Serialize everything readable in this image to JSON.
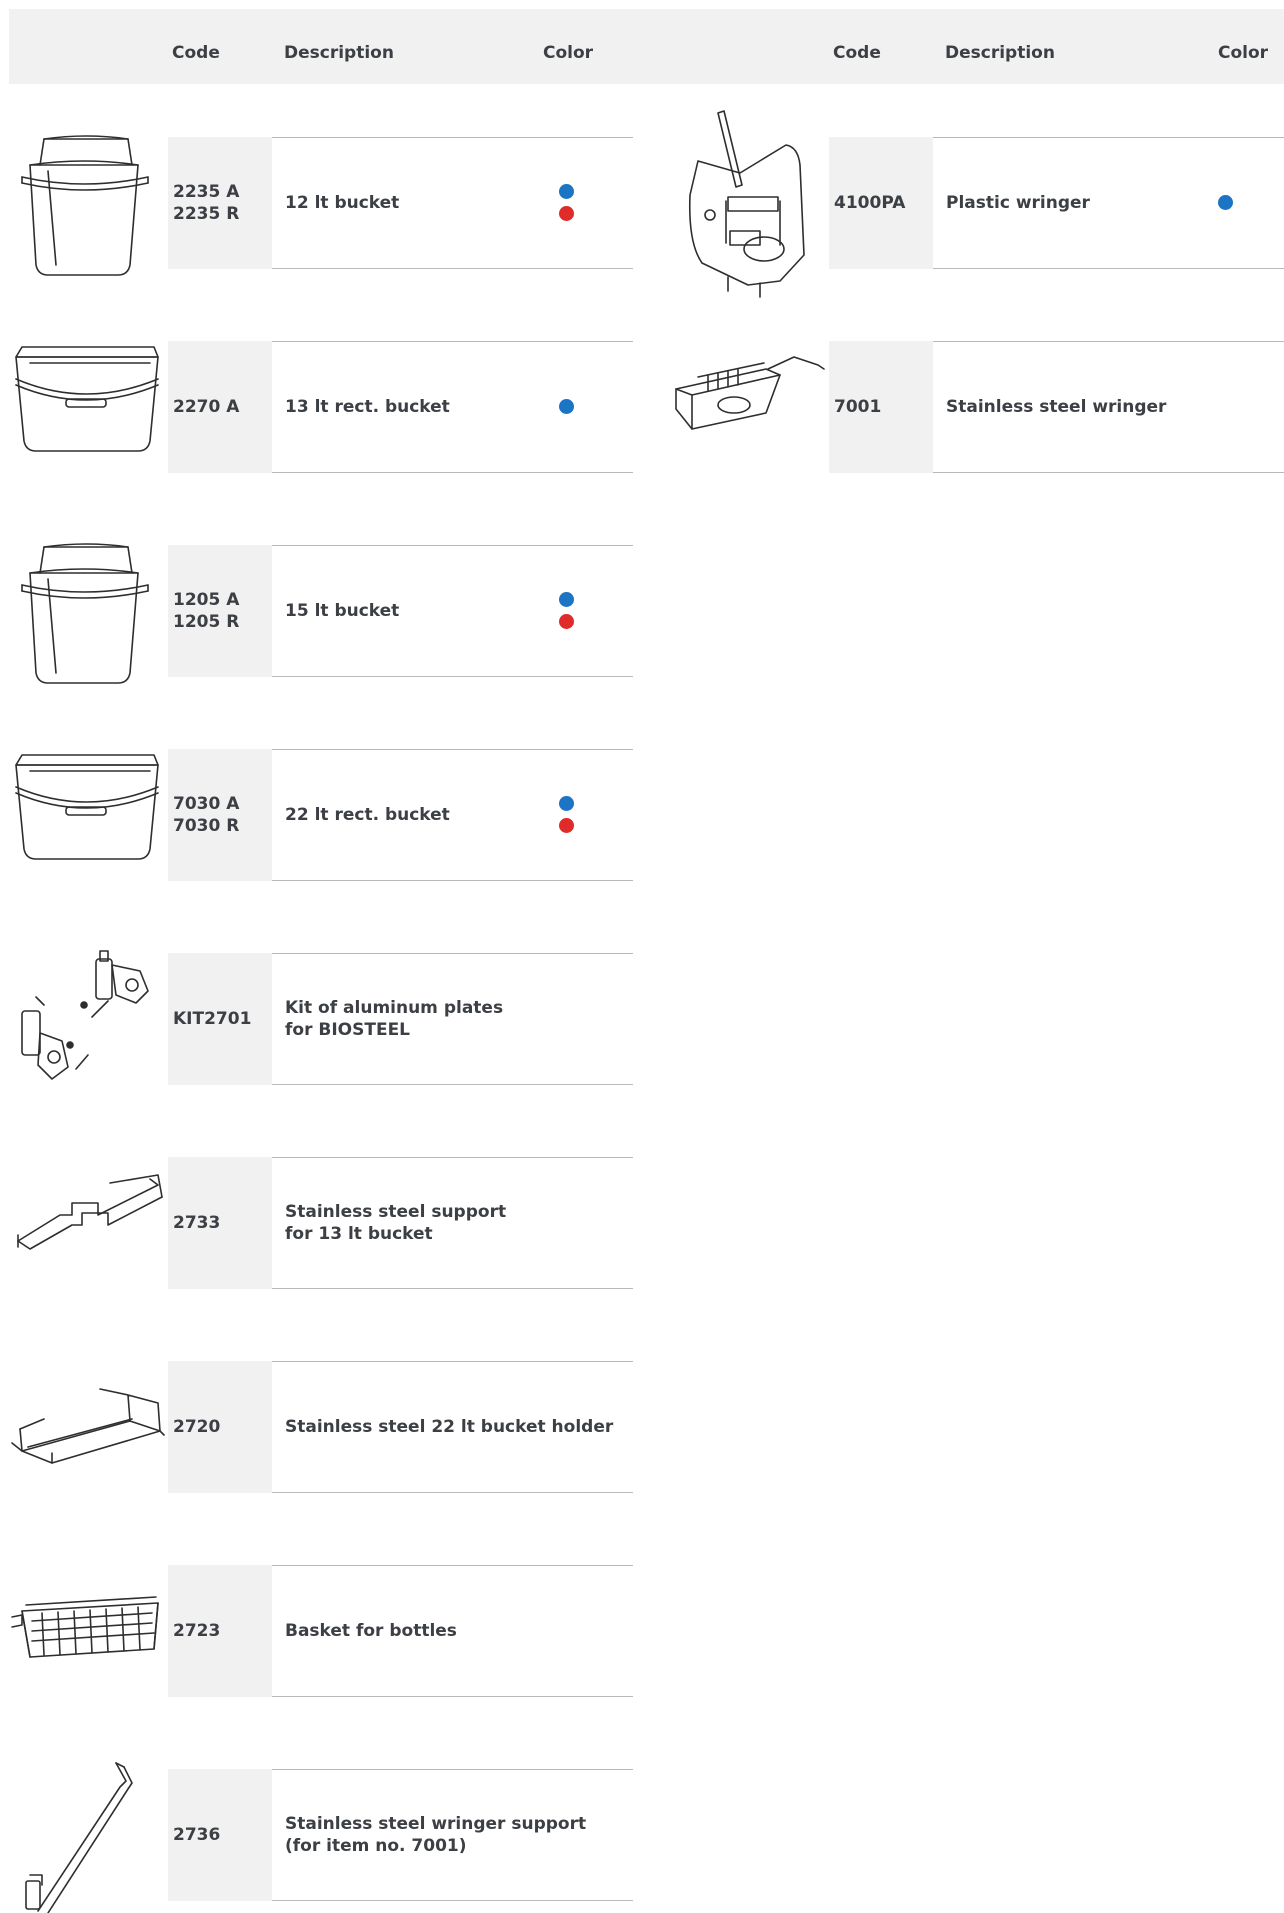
{
  "header": {
    "left": {
      "code": "Code",
      "description": "Description",
      "color": "Color"
    },
    "right": {
      "code": "Code",
      "description": "Description",
      "color": "Color"
    }
  },
  "colors": {
    "blue": "#1b75c4",
    "red": "#e02b2b",
    "code_bg": "#f1f1f2",
    "header_bg": "#f1f1f2",
    "rule": "#b7b8ba"
  },
  "left_items": [
    {
      "code": "2235 A\n2235 R",
      "description": "12 lt bucket",
      "colors": [
        "blue",
        "red"
      ],
      "image": "bucket-icon"
    },
    {
      "code": "2270 A",
      "description": "13 lt rect. bucket",
      "colors": [
        "blue"
      ],
      "image": "rect-bucket-icon"
    },
    {
      "code": "1205 A\n1205 R",
      "description": "15 lt bucket",
      "colors": [
        "blue",
        "red"
      ],
      "image": "bucket-icon"
    },
    {
      "code": "7030 A\n7030 R",
      "description": "22 lt rect. bucket",
      "colors": [
        "blue",
        "red"
      ],
      "image": "rect-bucket-icon"
    },
    {
      "code": "KIT2701",
      "description": "Kit of aluminum plates\nfor BIOSTEEL",
      "colors": [],
      "image": "plates-kit-icon"
    },
    {
      "code": "2733",
      "description": "Stainless steel support\nfor 13 lt bucket",
      "colors": [],
      "image": "wire-support-icon"
    },
    {
      "code": "2720",
      "description": "Stainless steel 22 lt bucket holder",
      "colors": [],
      "image": "bucket-holder-icon"
    },
    {
      "code": "2723",
      "description": "Basket for bottles",
      "colors": [],
      "image": "basket-icon"
    },
    {
      "code": "2736",
      "description": "Stainless steel wringer support\n(for item no. 7001)",
      "colors": [],
      "image": "wringer-support-icon"
    }
  ],
  "right_items": [
    {
      "code": "4100PA",
      "description": "Plastic wringer",
      "colors": [
        "blue"
      ],
      "image": "plastic-wringer-icon"
    },
    {
      "code": "7001",
      "description": "Stainless steel wringer",
      "colors": [],
      "image": "steel-wringer-icon"
    }
  ]
}
